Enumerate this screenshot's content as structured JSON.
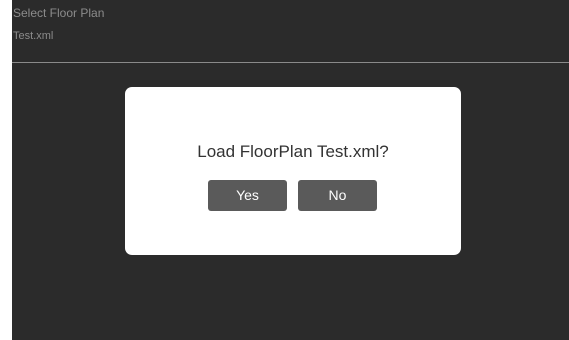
{
  "header": {
    "title": "Select Floor Plan"
  },
  "file_list": {
    "items": [
      "Test.xml"
    ]
  },
  "dialog": {
    "message": "Load FloorPlan Test.xml?",
    "yes_label": "Yes",
    "no_label": "No"
  }
}
